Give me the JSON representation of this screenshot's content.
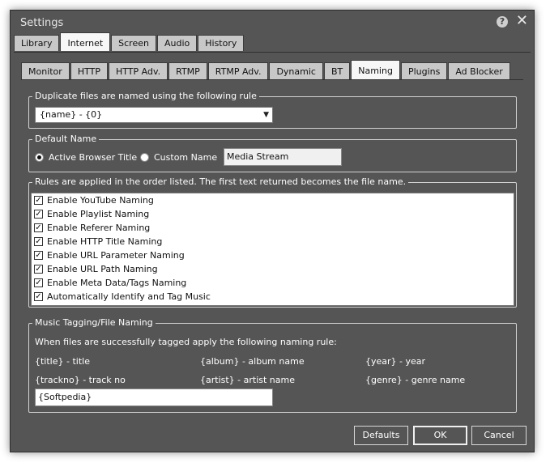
{
  "window": {
    "title": "Settings"
  },
  "top_tabs": [
    "Library",
    "Internet",
    "Screen",
    "Audio",
    "History"
  ],
  "sub_tabs": [
    "Monitor",
    "HTTP",
    "HTTP Adv.",
    "RTMP",
    "RTMP Adv.",
    "Dynamic",
    "BT",
    "Naming",
    "Plugins",
    "Ad Blocker"
  ],
  "duplicate": {
    "legend": "Duplicate files are named using the following rule",
    "selected": "{name} - {0}"
  },
  "default_name": {
    "legend": "Default Name",
    "option1": "Active Browser Title",
    "option2": "Custom Name",
    "custom_value": "Media Stream"
  },
  "rules": {
    "legend": "Rules are applied in the order listed.  The first text returned becomes the file name.",
    "items": [
      "Enable YouTube Naming",
      "Enable Playlist Naming",
      "Enable Referer Naming",
      "Enable HTTP Title Naming",
      "Enable URL Parameter Naming",
      "Enable URL Path Naming",
      "Enable Meta Data/Tags Naming",
      "Automatically Identify and Tag Music"
    ]
  },
  "music": {
    "legend": "Music Tagging/File Naming",
    "description": "When files are successfully tagged apply the following naming rule:",
    "tokens": [
      "{title} - title",
      "{album} - album name",
      "{year} - year",
      "{trackno} - track no",
      "{artist} - artist name",
      "{genre} - genre name"
    ],
    "pattern": "{Softpedia}"
  },
  "buttons": {
    "defaults": "Defaults",
    "ok": "OK",
    "cancel": "Cancel"
  }
}
